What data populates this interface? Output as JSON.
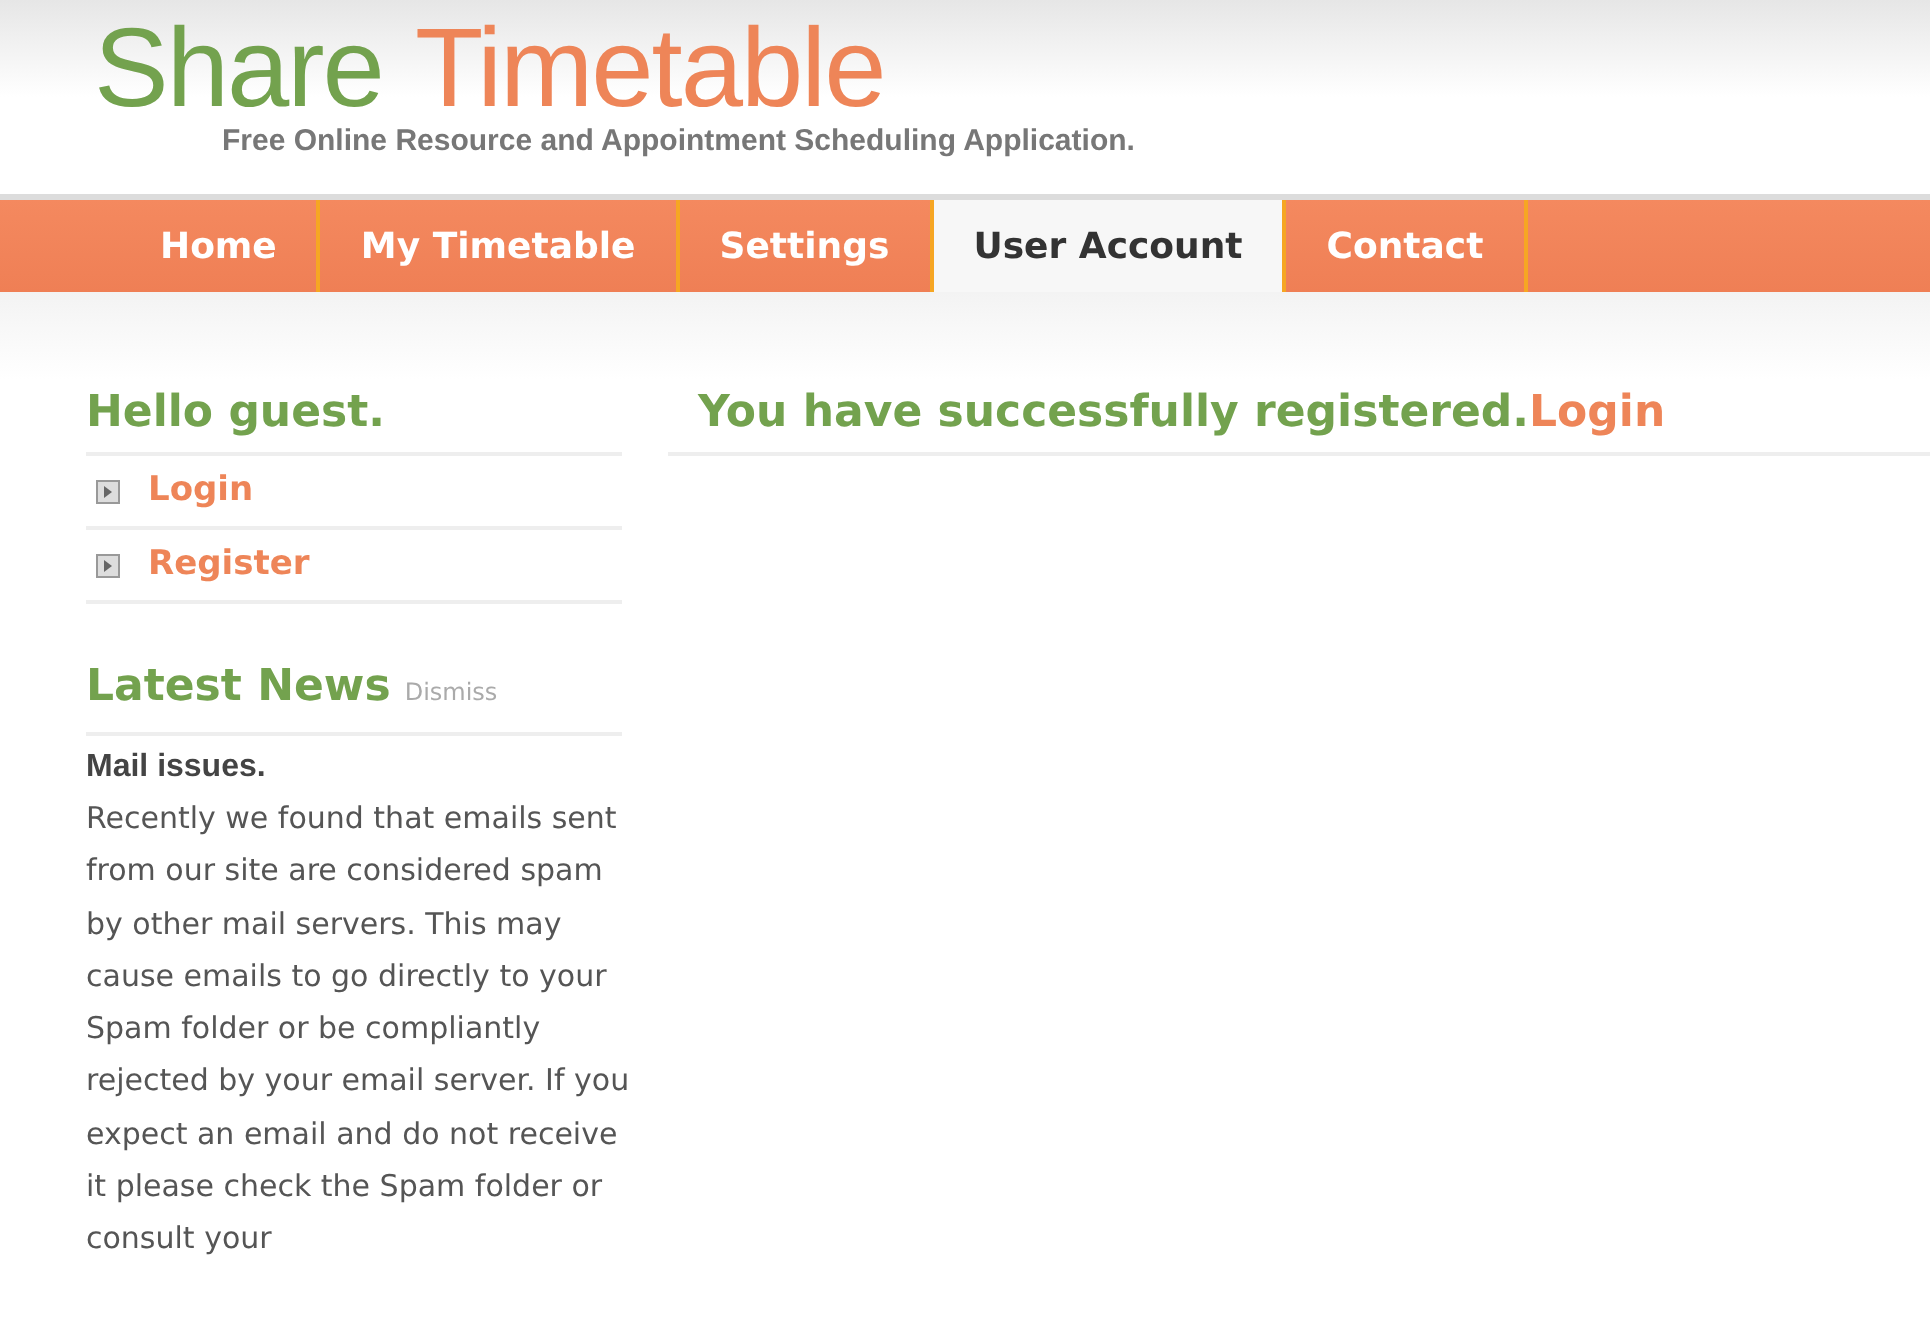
{
  "logo": {
    "first": "Share",
    "second": "Timetable"
  },
  "tagline": "Free Online Resource and Appointment Scheduling Application.",
  "nav": [
    {
      "label": "Home",
      "selected": false
    },
    {
      "label": "My Timetable",
      "selected": false
    },
    {
      "label": "Settings",
      "selected": false
    },
    {
      "label": "User Account",
      "selected": true
    },
    {
      "label": "Contact",
      "selected": false
    }
  ],
  "sidebar": {
    "greeting": "Hello guest.",
    "links": [
      "Login",
      "Register"
    ]
  },
  "news": {
    "title": "Latest News",
    "dismiss": "Dismiss",
    "headline": "Mail issues.",
    "body": "Recently we found that emails sent from our site are considered spam by other mail servers. This may cause emails to go directly to your Spam folder or be compliantly rejected by your email server. If you expect an email and do not receive it please check the Spam folder or consult your"
  },
  "message": {
    "text": "You have successfully registered.",
    "link": "Login"
  }
}
